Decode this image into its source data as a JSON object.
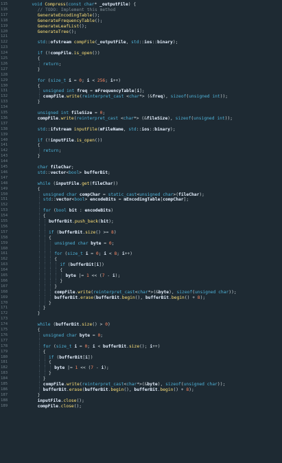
{
  "editor": {
    "language": "C++",
    "lines": [
      {
        "n": "115",
        "t": "void Compress(const char* _outputFile) {",
        "i": 2
      },
      {
        "n": "116",
        "t": "// TODO: Implement this method",
        "i": 3
      },
      {
        "n": "117",
        "t": "GenerateEncodingTable();",
        "i": 3
      },
      {
        "n": "118",
        "t": "GenerateFrequencyTable();",
        "i": 3
      },
      {
        "n": "119",
        "t": "GenerateLeafList();",
        "i": 3
      },
      {
        "n": "120",
        "t": "GenerateTree();",
        "i": 3
      },
      {
        "n": "121",
        "t": "",
        "i": 3
      },
      {
        "n": "122",
        "t": "std::ofstream compFile(_outputFile, std::ios::binary);",
        "i": 3
      },
      {
        "n": "123",
        "t": "",
        "i": 3
      },
      {
        "n": "124",
        "t": "if (!compFile.is_open())",
        "i": 3
      },
      {
        "n": "125",
        "t": "{",
        "i": 3
      },
      {
        "n": "126",
        "t": "return;",
        "i": 4
      },
      {
        "n": "127",
        "t": "}",
        "i": 3
      },
      {
        "n": "128",
        "t": "",
        "i": 3
      },
      {
        "n": "129",
        "t": "for (size_t i = 0; i < 256; i++)",
        "i": 3
      },
      {
        "n": "130",
        "t": "{",
        "i": 3
      },
      {
        "n": "131",
        "t": "unsigned int freq = mFrequencyTable[i];",
        "i": 4
      },
      {
        "n": "132",
        "t": "compFile.write(reinterpret_cast <char*> (&freq), sizeof(unsigned int));",
        "i": 4
      },
      {
        "n": "133",
        "t": "}",
        "i": 3
      },
      {
        "n": "134",
        "t": "",
        "i": 3
      },
      {
        "n": "135",
        "t": "unsigned int fileSize = 0;",
        "i": 3
      },
      {
        "n": "136",
        "t": "compFile.write(reinterpret_cast <char*> (&fileSize), sizeof(unsigned int));",
        "i": 3
      },
      {
        "n": "137",
        "t": "",
        "i": 3
      },
      {
        "n": "138",
        "t": "std::ifstream inputFile(mFileName, std::ios::binary);",
        "i": 3
      },
      {
        "n": "139",
        "t": "",
        "i": 3
      },
      {
        "n": "140",
        "t": "if (!inputFile.is_open())",
        "i": 3
      },
      {
        "n": "141",
        "t": "{",
        "i": 3
      },
      {
        "n": "142",
        "t": "return;",
        "i": 4
      },
      {
        "n": "143",
        "t": "}",
        "i": 3
      },
      {
        "n": "144",
        "t": "",
        "i": 3
      },
      {
        "n": "145",
        "t": "char fileChar;",
        "i": 3
      },
      {
        "n": "146",
        "t": "std::vector<bool> bufferBit;",
        "i": 3
      },
      {
        "n": "147",
        "t": "",
        "i": 3
      },
      {
        "n": "148",
        "t": "while (inputFile.get(fileChar))",
        "i": 3
      },
      {
        "n": "149",
        "t": "{",
        "i": 3
      },
      {
        "n": "150",
        "t": "unsigned char compChar = static_cast<unsigned char>(fileChar);",
        "i": 4
      },
      {
        "n": "151",
        "t": "std::vector<bool> encodeBits = mEncodingTable[compChar];",
        "i": 4
      },
      {
        "n": "152",
        "t": "",
        "i": 4
      },
      {
        "n": "153",
        "t": "for (bool bit : encodeBits)",
        "i": 4
      },
      {
        "n": "154",
        "t": "{",
        "i": 4
      },
      {
        "n": "155",
        "t": "bufferBit.push_back(bit);",
        "i": 5
      },
      {
        "n": "156",
        "t": "",
        "i": 5
      },
      {
        "n": "157",
        "t": "if (bufferBit.size() >= 8)",
        "i": 5
      },
      {
        "n": "158",
        "t": "{",
        "i": 5
      },
      {
        "n": "159",
        "t": "unsigned char byte = 0;",
        "i": 6
      },
      {
        "n": "160",
        "t": "",
        "i": 6
      },
      {
        "n": "161",
        "t": "for (size_t i = 0; i < 8; i++)",
        "i": 6
      },
      {
        "n": "162",
        "t": "{",
        "i": 6
      },
      {
        "n": "163",
        "t": "if (bufferBit[i])",
        "i": 7
      },
      {
        "n": "164",
        "t": "{",
        "i": 7
      },
      {
        "n": "165",
        "t": "byte |= 1 << (7 - i);",
        "i": 8
      },
      {
        "n": "166",
        "t": "}",
        "i": 7
      },
      {
        "n": "167",
        "t": "}",
        "i": 6
      },
      {
        "n": "168",
        "t": "compFile.write(reinterpret_cast<char*>(&byte), sizeof(unsigned char));",
        "i": 6
      },
      {
        "n": "169",
        "t": "bufferBit.erase(bufferBit.begin(), bufferBit.begin() + 8);",
        "i": 6
      },
      {
        "n": "170",
        "t": "}",
        "i": 5
      },
      {
        "n": "171",
        "t": "}",
        "i": 4
      },
      {
        "n": "172",
        "t": "}",
        "i": 3
      },
      {
        "n": "173",
        "t": "",
        "i": 3
      },
      {
        "n": "174",
        "t": "while (bufferBit.size() > 0)",
        "i": 3
      },
      {
        "n": "175",
        "t": "{",
        "i": 3
      },
      {
        "n": "176",
        "t": "unsigned char byte = 0;",
        "i": 4
      },
      {
        "n": "177",
        "t": "",
        "i": 4
      },
      {
        "n": "178",
        "t": "for (size_t i = 0; i < bufferBit.size(); i++)",
        "i": 4
      },
      {
        "n": "179",
        "t": "{",
        "i": 4
      },
      {
        "n": "180",
        "t": "if (bufferBit[i])",
        "i": 5
      },
      {
        "n": "181",
        "t": "{",
        "i": 5
      },
      {
        "n": "182",
        "t": "byte |= 1 << (7 - i);",
        "i": 6
      },
      {
        "n": "183",
        "t": "}",
        "i": 5
      },
      {
        "n": "184",
        "t": "}",
        "i": 4
      },
      {
        "n": "185",
        "t": "compFile.write(reinterpret_cast<char*>(&byte), sizeof(unsigned char));",
        "i": 4
      },
      {
        "n": "186",
        "t": "bufferBit.erase(bufferBit.begin(), bufferBit.begin() + 8);",
        "i": 4
      },
      {
        "n": "187",
        "t": "}",
        "i": 3
      },
      {
        "n": "188",
        "t": "inputFile.close();",
        "i": 3
      },
      {
        "n": "189",
        "t": "compFile.close();",
        "i": 3
      }
    ]
  }
}
